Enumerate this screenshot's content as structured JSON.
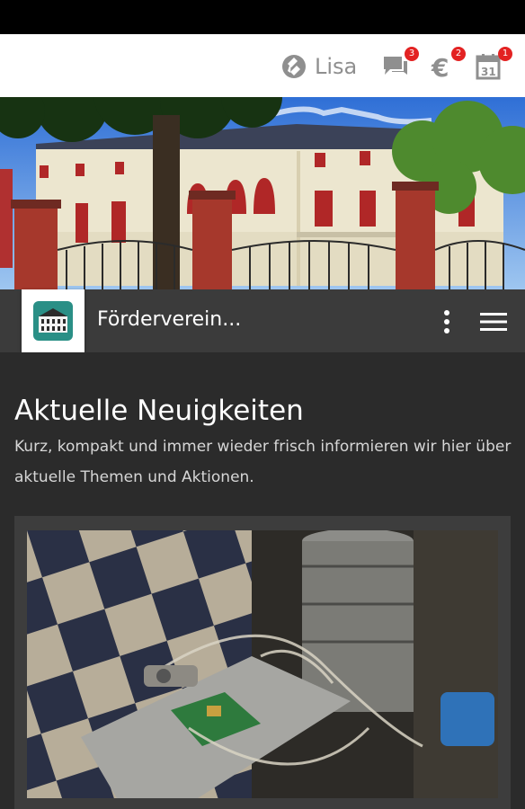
{
  "topbar": {
    "user_name": "Lisa",
    "badges": {
      "messages": "3",
      "payments": "2",
      "calendar": "1"
    },
    "calendar_day": "31",
    "payments_symbol": "€"
  },
  "club": {
    "name": "Förderverein..."
  },
  "main": {
    "heading": "Aktuelle Neuigkeiten",
    "description": "Kurz, kompakt und immer wieder frisch informieren wir hier über aktuelle Themen und Aktionen."
  },
  "colors": {
    "badge": "#e32222",
    "topbar_icon": "#8f8f8f",
    "dark_bg": "#2b2b2b",
    "club_bar": "#3b3b3b"
  }
}
